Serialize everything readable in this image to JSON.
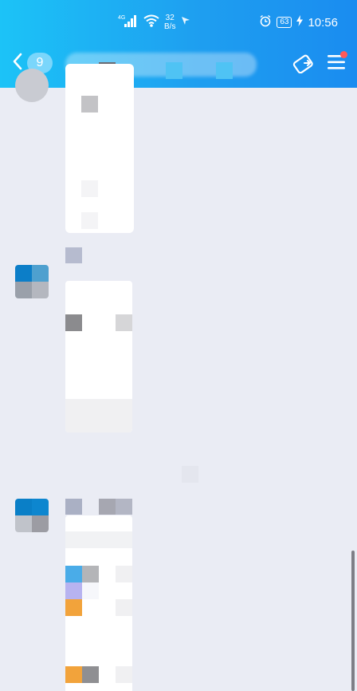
{
  "status_bar": {
    "network_label": "4G",
    "speed_value": "32",
    "speed_unit": "B/s",
    "battery": "63",
    "time": "10:56"
  },
  "nav": {
    "unread_count": "9"
  },
  "colors": {
    "header_start": "#1cc3f7",
    "header_end": "#1a8cf0",
    "chat_background": "#eaecf4",
    "notification_dot": "#ff5959"
  },
  "icons": {
    "back": "chevron-left-icon",
    "lock_share": "lock-share-icon",
    "menu": "menu-icon",
    "alarm": "alarm-icon",
    "signal": "signal-icon",
    "wifi": "wifi-icon",
    "bolt": "charging-icon"
  }
}
